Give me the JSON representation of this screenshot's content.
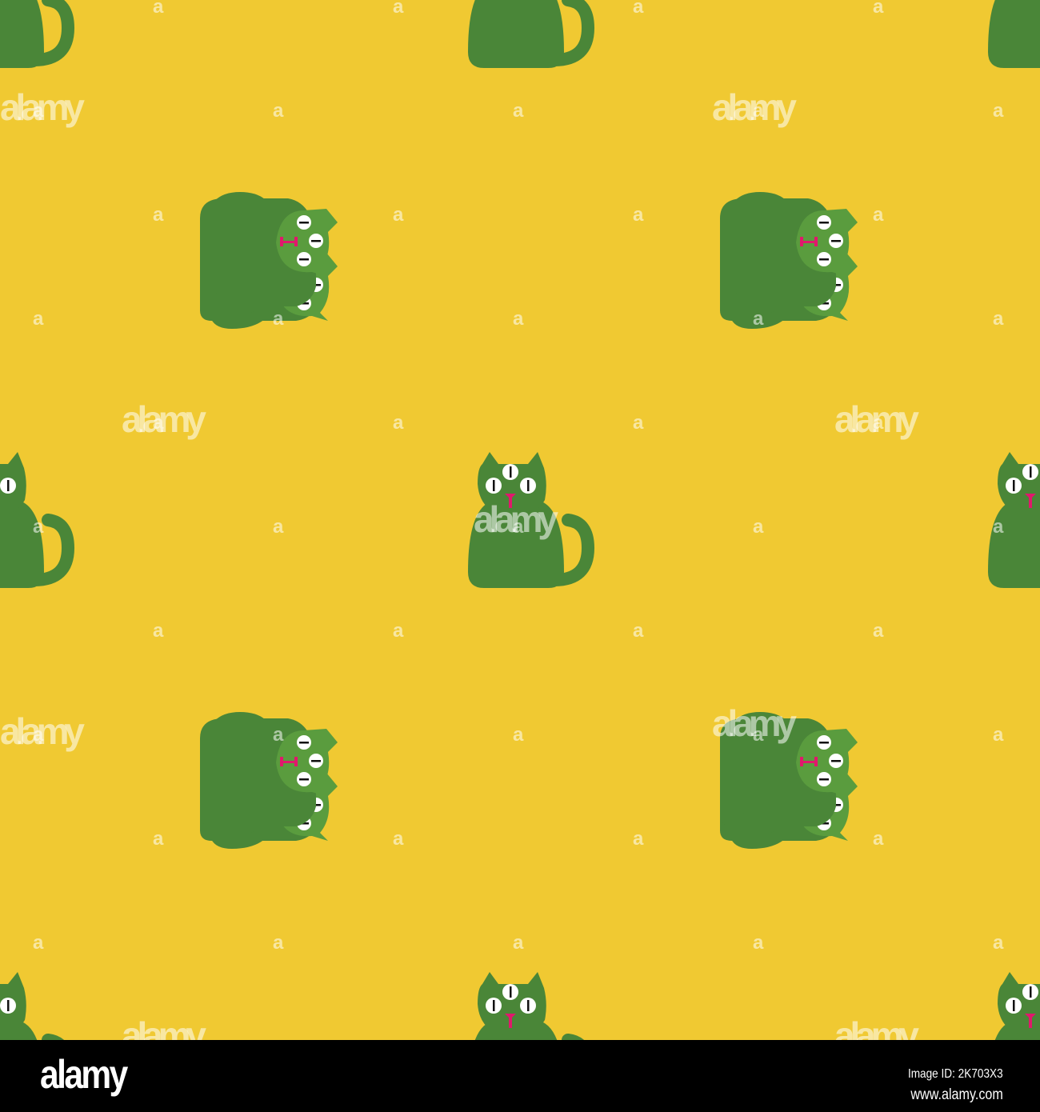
{
  "colors": {
    "background": "#f0c932",
    "cat": "#4a8638",
    "face": "#5a9c3e",
    "eye": "#ffffff",
    "pupil": "#111111",
    "nose": "#e0186c"
  },
  "watermark": {
    "text": "alamy",
    "small": "a"
  },
  "footer": {
    "logo": "alamy",
    "image_id": "Image ID: 2K703X3",
    "url": "www.alamy.com"
  }
}
